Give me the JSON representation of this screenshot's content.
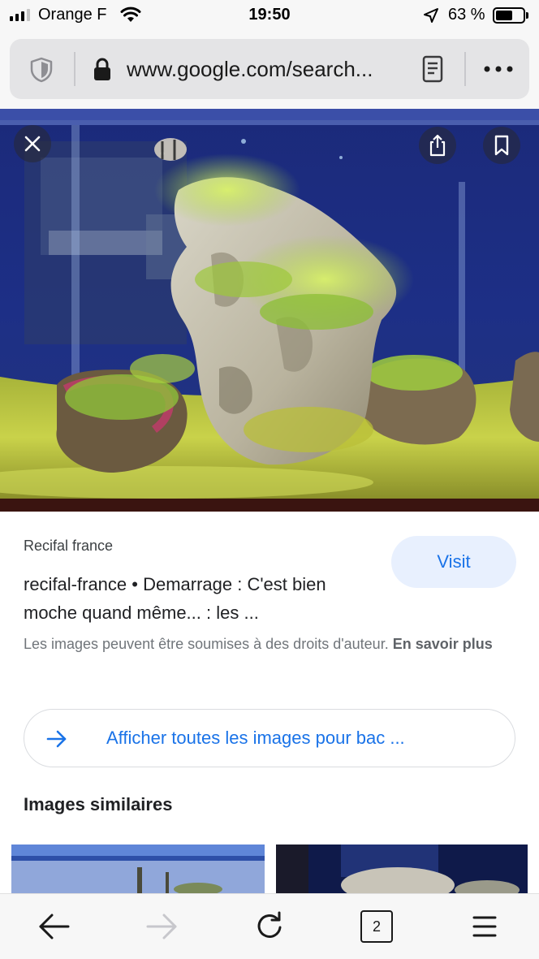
{
  "status_bar": {
    "carrier": "Orange F",
    "time": "19:50",
    "battery_percent": "63 %",
    "battery_level": 0.63,
    "signal_bars_active": 3,
    "signal_bars_total": 4,
    "icons": [
      "signal-icon",
      "wifi-icon",
      "location-arrow-icon",
      "battery-icon"
    ]
  },
  "url_bar": {
    "url": "www.google.com/search...",
    "icons": [
      "shield-icon",
      "lock-icon",
      "reader-view-icon",
      "more-icon"
    ]
  },
  "viewer": {
    "close_icon": "close-icon",
    "share_icon": "share-icon",
    "bookmark_icon": "bookmark-icon"
  },
  "result": {
    "source": "Recifal france",
    "visit_label": "Visit",
    "title": "recifal-france • Demarrage : C'est bien moche quand même... : les ...",
    "copyright_text": "Les images peuvent être soumises à des droits d'auteur.",
    "learn_more": "En savoir plus",
    "show_all_label": "Afficher toutes les images pour bac ...",
    "similar_heading": "Images similaires"
  },
  "toolbar": {
    "tab_count": "2",
    "icons": [
      "back-arrow-icon",
      "forward-arrow-icon",
      "reload-icon",
      "tabs-icon",
      "menu-icon"
    ]
  },
  "colors": {
    "accent": "#1a73e8",
    "visit_bg": "#e8f0fe",
    "chrome_bg": "#f7f7f7",
    "url_bar_bg": "#e4e4e6"
  }
}
